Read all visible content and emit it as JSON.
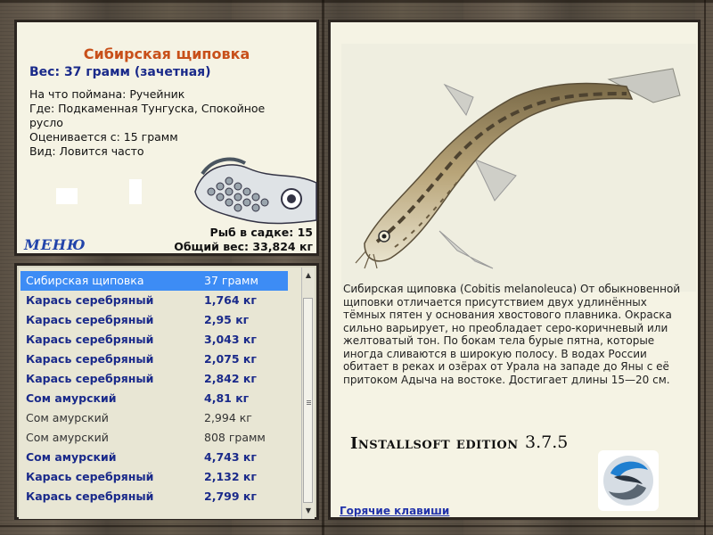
{
  "catch": {
    "title": "Сибирская щиповка",
    "weight": "Вес: 37 грамм (зачетная)",
    "bait": "На что поймана: Ручейник",
    "place": "Где: Подкаменная Тунгуска, Спокойное русло",
    "rated_from": "Оценивается с: 15 грамм",
    "kind": "Вид: Ловится часто",
    "menu_label": "МЕНЮ",
    "keep_count": "Рыб в садке: 15",
    "total_weight": "Общий вес: 33,824 кг"
  },
  "catch_list": [
    {
      "name": "Сибирская щиповка",
      "weight": "37 грамм",
      "style": "selected"
    },
    {
      "name": "Карась серебряный",
      "weight": "1,764 кг",
      "style": "bold"
    },
    {
      "name": "Карась серебряный",
      "weight": "2,95 кг",
      "style": "bold"
    },
    {
      "name": "Карась серебряный",
      "weight": "3,043 кг",
      "style": "bold"
    },
    {
      "name": "Карась серебряный",
      "weight": "2,075 кг",
      "style": "bold"
    },
    {
      "name": "Карась серебряный",
      "weight": "2,842 кг",
      "style": "bold"
    },
    {
      "name": "Сом амурский",
      "weight": "4,81 кг",
      "style": "bold"
    },
    {
      "name": "Сом амурский",
      "weight": "2,994 кг",
      "style": "plain"
    },
    {
      "name": "Сом амурский",
      "weight": "808 грамм",
      "style": "plain"
    },
    {
      "name": "Сом амурский",
      "weight": "4,743 кг",
      "style": "bold"
    },
    {
      "name": "Карась серебряный",
      "weight": "2,132 кг",
      "style": "bold"
    },
    {
      "name": "Карась серебряный",
      "weight": "2,799 кг",
      "style": "bold"
    }
  ],
  "info": {
    "description": "Сибирская щиповка (Cobitis melanoleuca) От обыкновенной щиповки отличается присутствием двух удлинённых тёмных пятен у основания хвостового плавника. Окраска сильно варьирует, но преобладает серо-коричневый или желтоватый тон. По бокам тела бурые пятна, которые иногда сливаются в широкую полосу. В водах России обитает в реках и озёрах от Урала на западе до Яны с её притоком Адыча на востоке. Достигает длины 15—20 см.",
    "edition": "Installsoft edition",
    "version": "3.7.5",
    "hotkeys_label": "Горячие клавиши"
  },
  "icons": {
    "scroll_up": "chevron-up-icon",
    "scroll_down": "chevron-down-icon",
    "logo": "installsoft-logo-icon",
    "emblem": "fish-emblem-icon"
  },
  "colors": {
    "selected_row": "#3d8cf5",
    "title_orange": "#c8501a",
    "link_blue": "#1a2a8a"
  }
}
